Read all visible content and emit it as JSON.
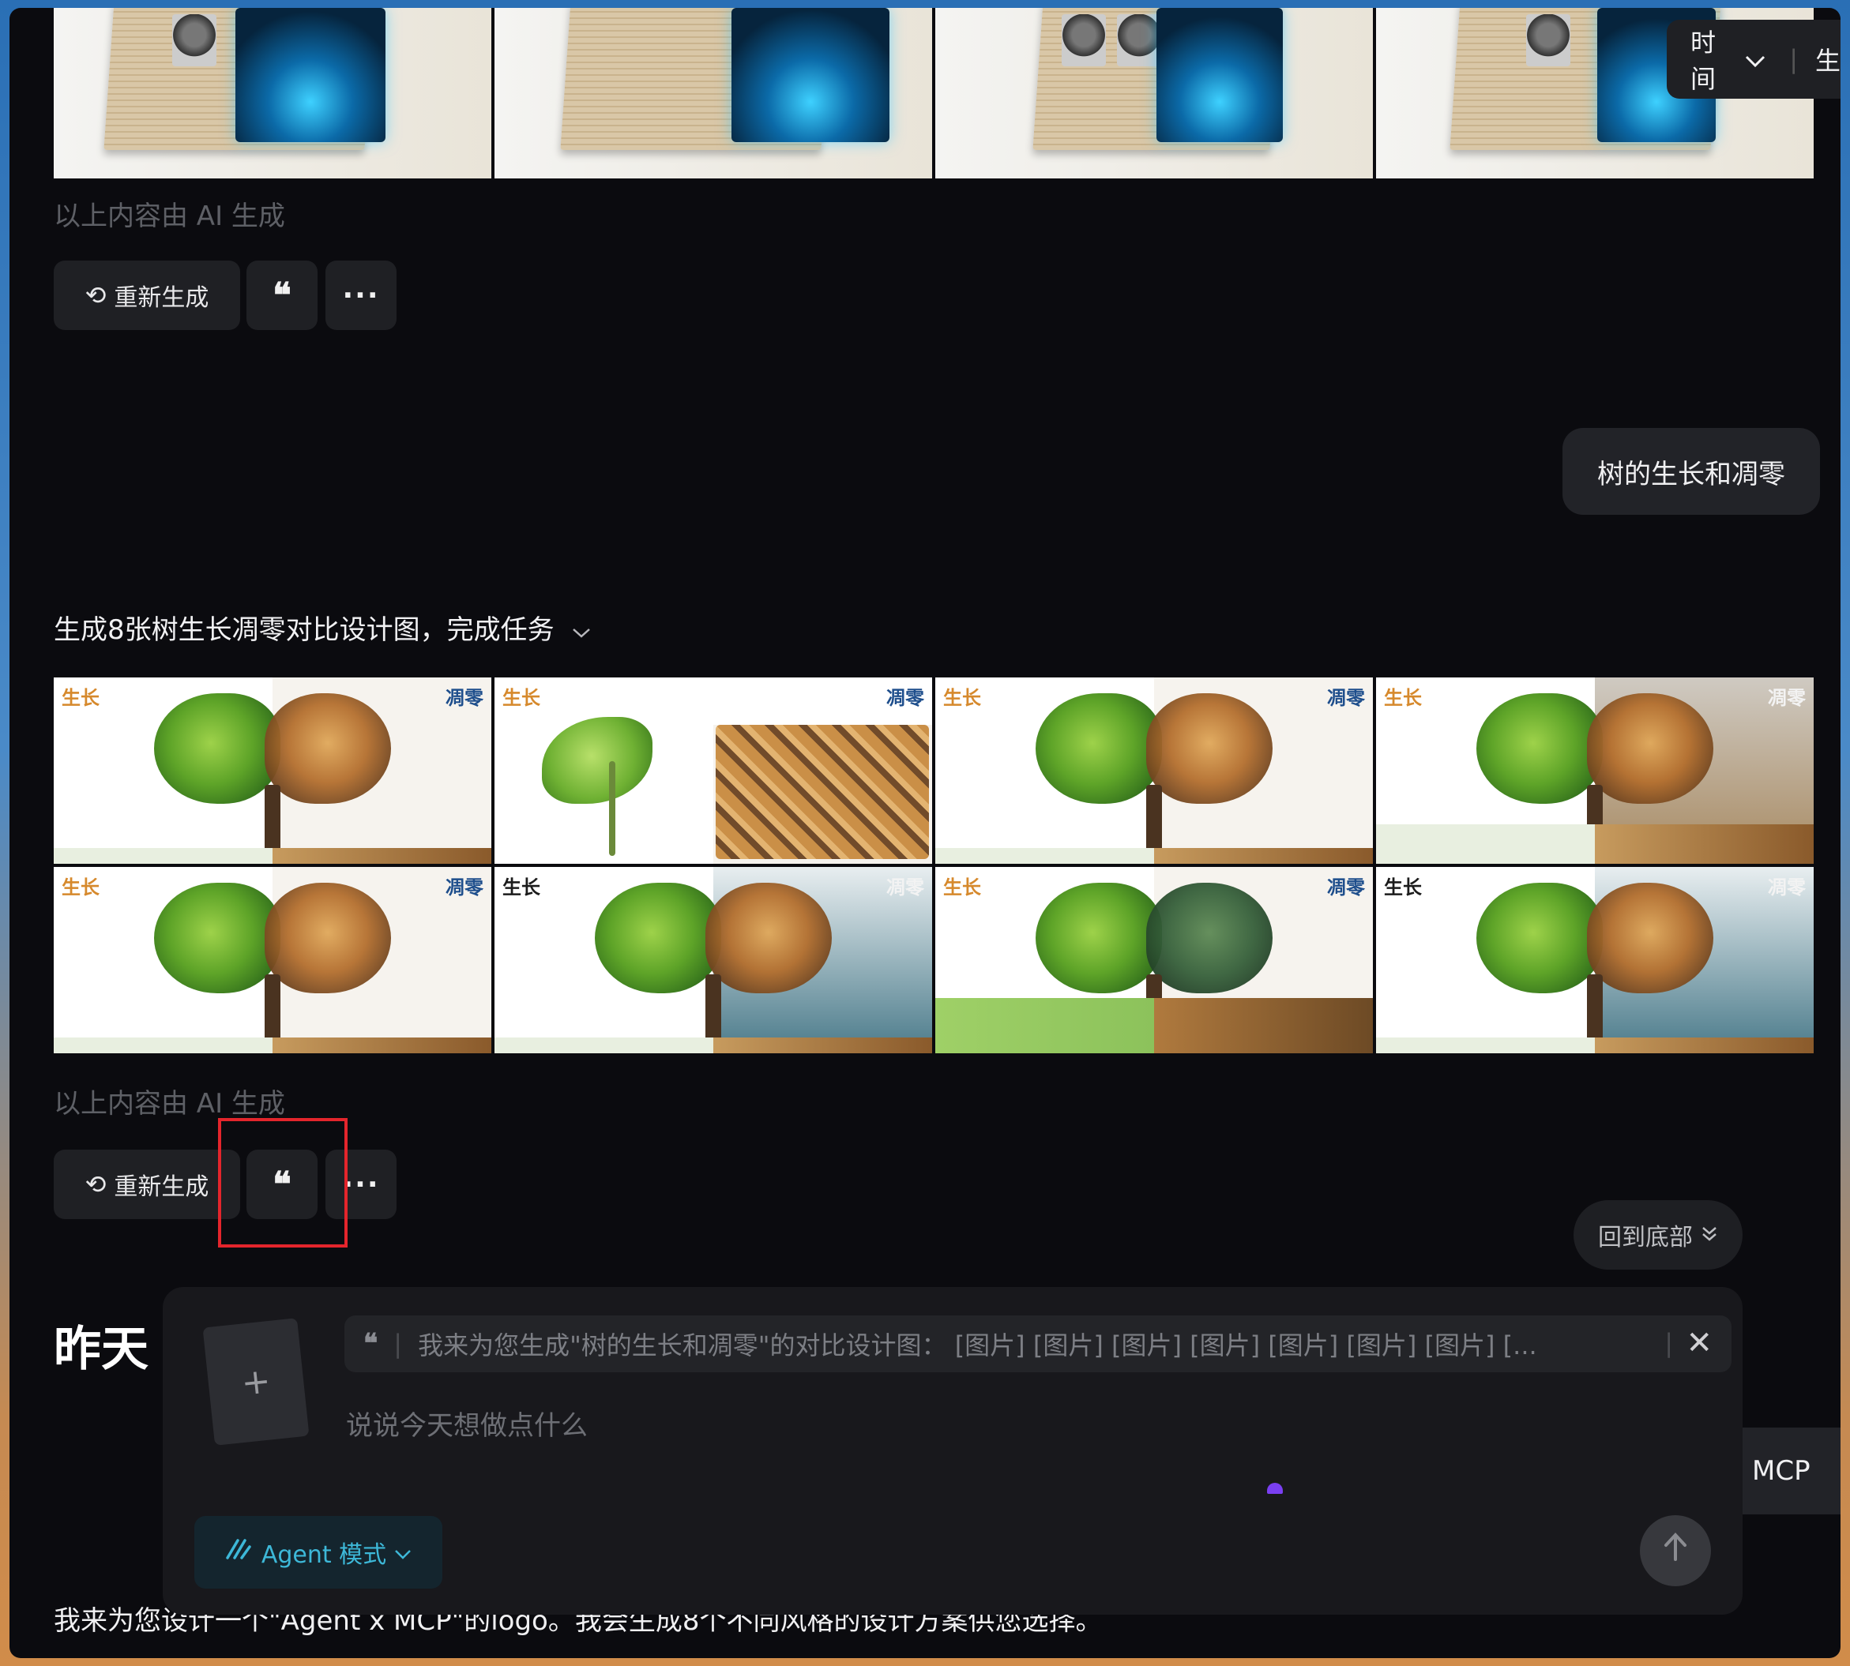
{
  "top_gallery": {
    "tiles": [
      {
        "type": "newspaper-digital"
      },
      {
        "type": "newspaper-tablet"
      },
      {
        "type": "newspaper-portraits"
      },
      {
        "type": "newspaper-portrait-screen"
      }
    ],
    "ai_note": "以上内容由 AI 生成",
    "actions": {
      "regenerate_label": "重新生成",
      "quote_icon": "❝",
      "more_icon": "···"
    }
  },
  "time_filter": {
    "label": "时间",
    "partial_right": "生"
  },
  "user_message": {
    "text": "树的生长和凋零"
  },
  "task": {
    "text": "生成8张树生长凋零对比设计图，完成任务",
    "chevron_icon": "chevron-down"
  },
  "tree_gallery": {
    "tiles": [
      {
        "grow": "生长",
        "wither": "凋零",
        "variant": "classic"
      },
      {
        "grow": "生长",
        "wither": "凋零",
        "variant": "sprout"
      },
      {
        "grow": "生长",
        "wither": "凋零",
        "variant": "classic"
      },
      {
        "grow": "生长",
        "wither": "凋零",
        "variant": "dark-right"
      },
      {
        "grow": "生长",
        "wither": "凋零",
        "variant": "classic"
      },
      {
        "grow": "生长",
        "wither": "凋零",
        "variant": "teal-right"
      },
      {
        "grow": "生长",
        "wither": "凋零",
        "variant": "field"
      },
      {
        "grow": "生长",
        "wither": "凋零",
        "variant": "teal-right"
      }
    ],
    "ai_note": "以上内容由 AI 生成",
    "actions": {
      "regenerate_label": "重新生成",
      "quote_icon": "❝",
      "more_icon": "···"
    }
  },
  "back_to_bottom": {
    "label": "回到底部",
    "icon": "double-chevron-down"
  },
  "section_heading": "昨天",
  "composer": {
    "quote_text": "我来为您生成\"树的生长和凋零\"的对比设计图：  [图片] [图片] [图片] [图片] [图片] [图片] [图片] [...",
    "upload_icon": "+",
    "placeholder": "说说今天想做点什么",
    "agent_mode_label": "Agent 模式",
    "send_icon": "arrow-up"
  },
  "partial_bubble": "MCP",
  "bottom_message": "我来为您设计一个\"Agent x MCP\"的logo。我会生成8个不同风格的设计方案供您选择。",
  "colors": {
    "background": "#0b0b0f",
    "button_bg": "#1f2024",
    "highlight_box": "#e4252c",
    "agent_accent": "#3db8d8",
    "cursor_dot": "#7a3ff2"
  }
}
